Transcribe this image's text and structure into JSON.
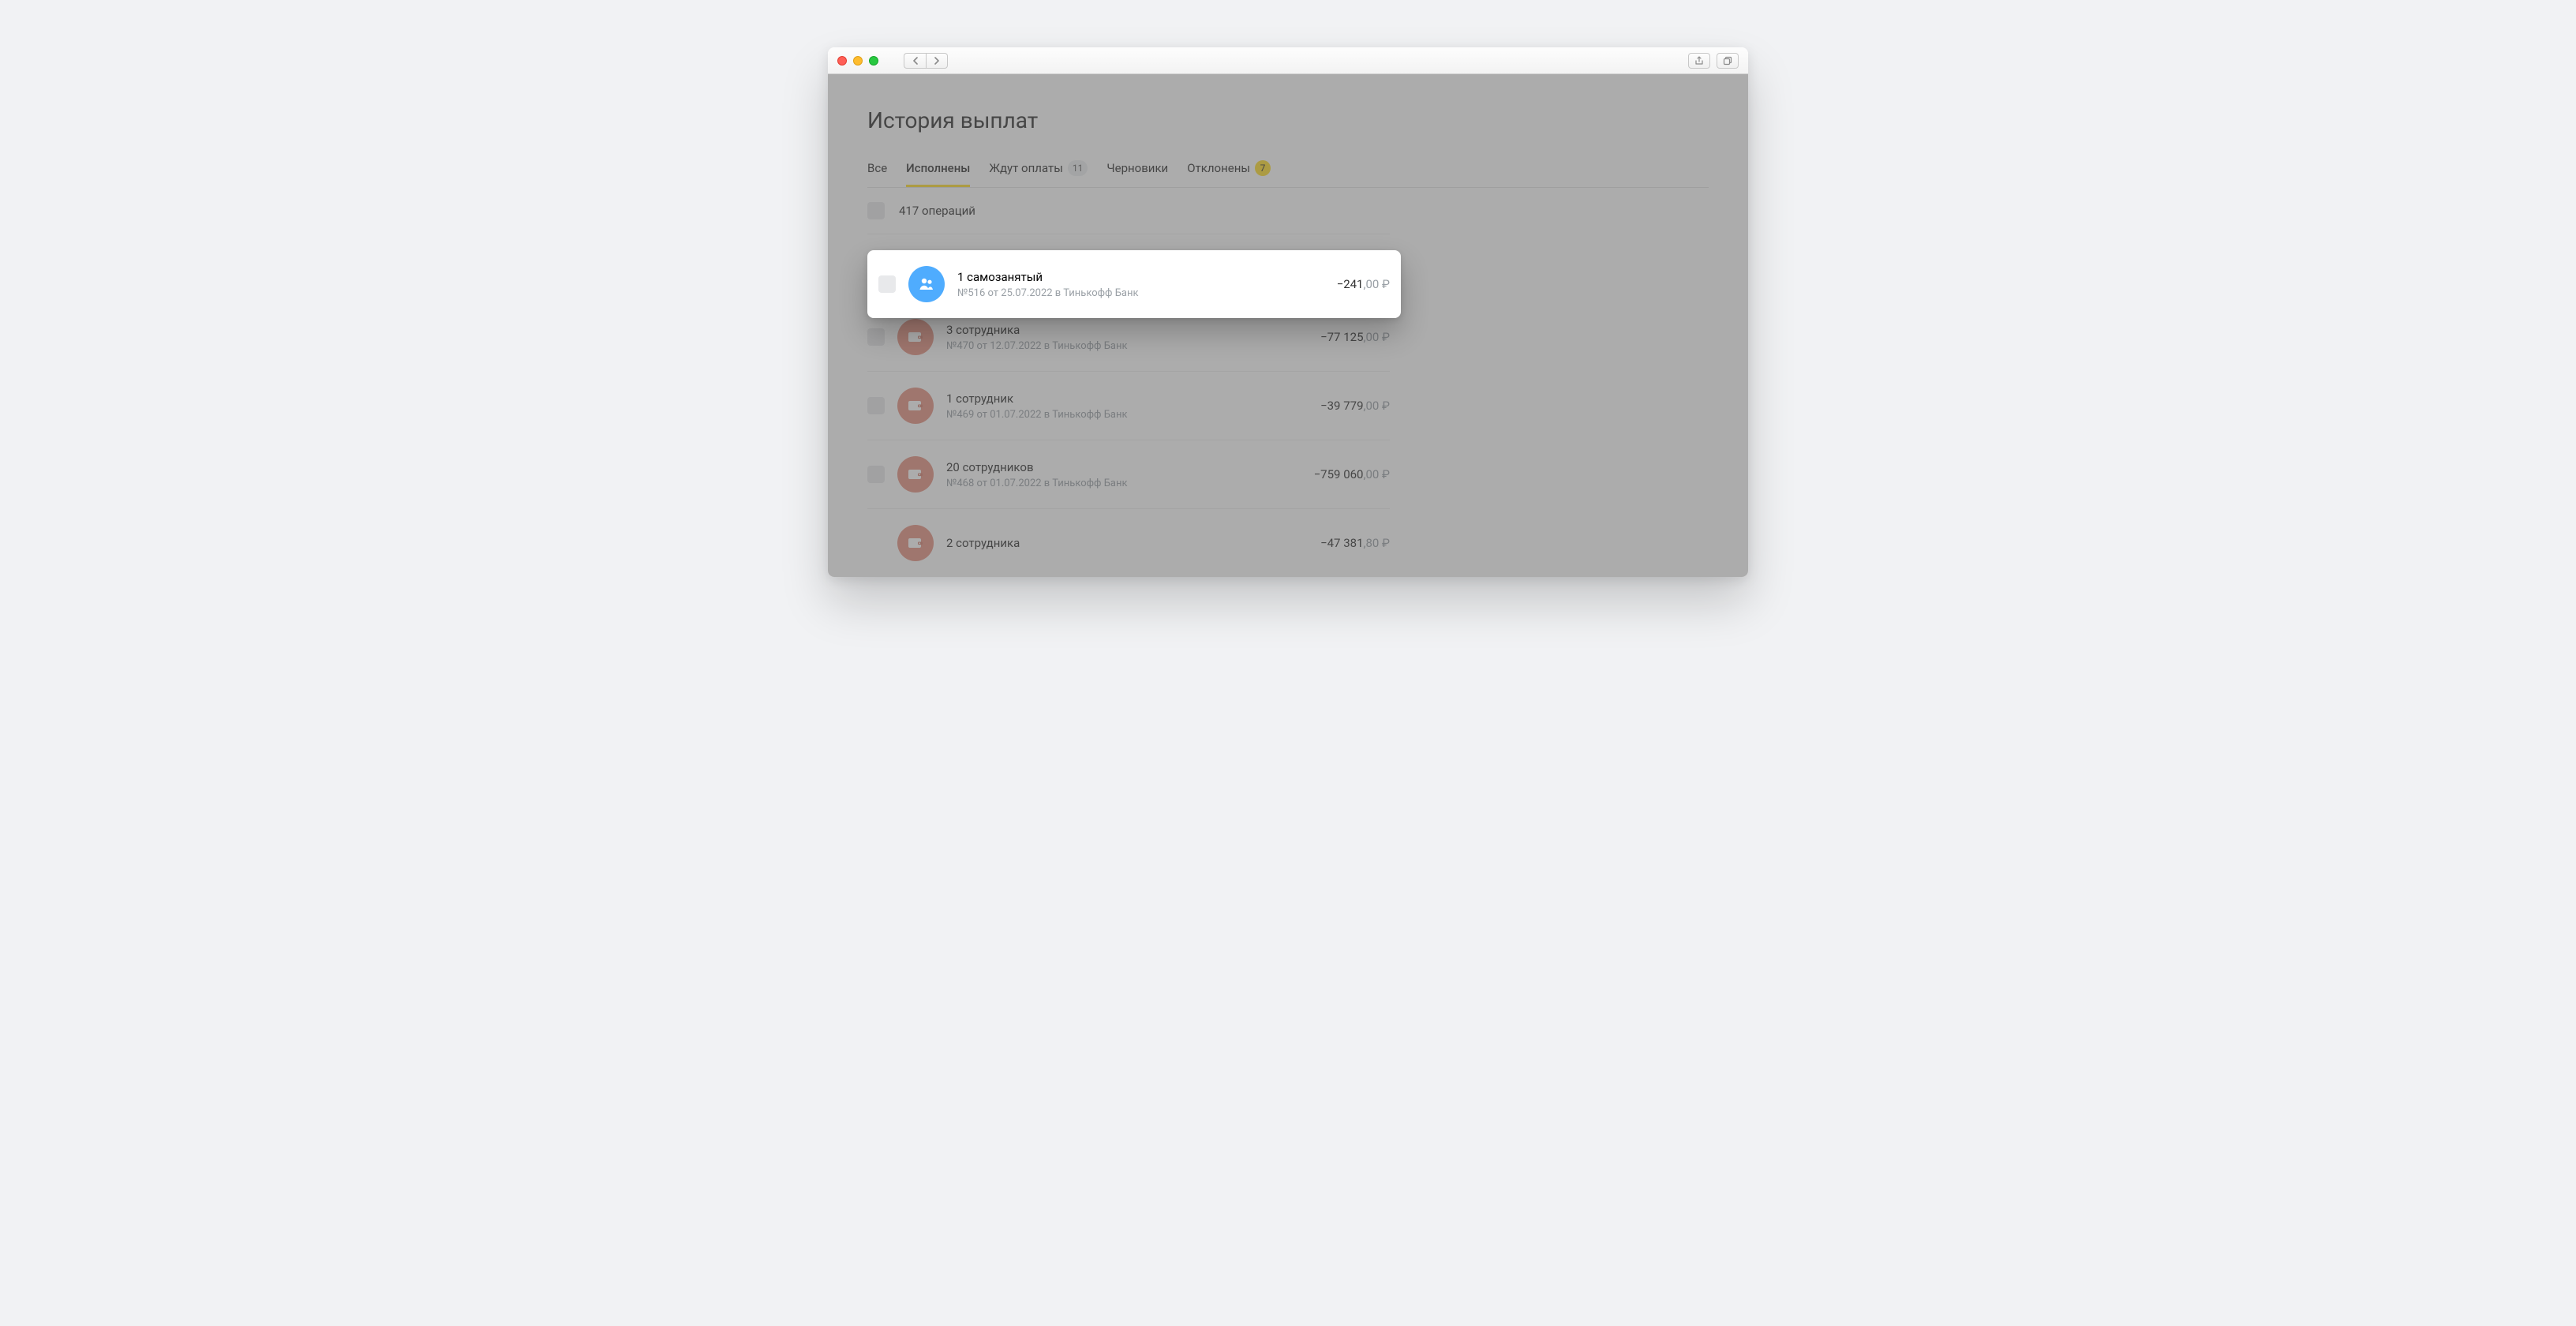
{
  "page": {
    "title": "История выплат"
  },
  "tabs": [
    {
      "label": "Все"
    },
    {
      "label": "Исполнены",
      "active": true
    },
    {
      "label": "Ждут оплаты",
      "badge": "11",
      "badgeStyle": "gray"
    },
    {
      "label": "Черновики"
    },
    {
      "label": "Отклонены",
      "badge": "7",
      "badgeStyle": "yellow"
    }
  ],
  "summary": {
    "text": "417 операций"
  },
  "operations": [
    {
      "title": "1 самозанятый",
      "sub": "№516 от 25.07.2022 в Тинькофф Банк",
      "amount_int": "−241",
      "amount_frac": ",00 ₽",
      "icon": "people",
      "highlighted": true
    },
    {
      "title": "3 сотрудника",
      "sub": "№470 от 12.07.2022 в Тинькофф Банк",
      "amount_int": "−77 125",
      "amount_frac": ",00 ₽",
      "icon": "wallet"
    },
    {
      "title": "1 сотрудник",
      "sub": "№469 от 01.07.2022 в Тинькофф Банк",
      "amount_int": "−39 779",
      "amount_frac": ",00 ₽",
      "icon": "wallet"
    },
    {
      "title": "20 сотрудников",
      "sub": "№468 от 01.07.2022 в Тинькофф Банк",
      "amount_int": "−759 060",
      "amount_frac": ",00 ₽",
      "icon": "wallet"
    },
    {
      "title": "2 сотрудника",
      "sub": "",
      "amount_int": "−47 381",
      "amount_frac": ",80 ₽",
      "icon": "wallet"
    }
  ]
}
